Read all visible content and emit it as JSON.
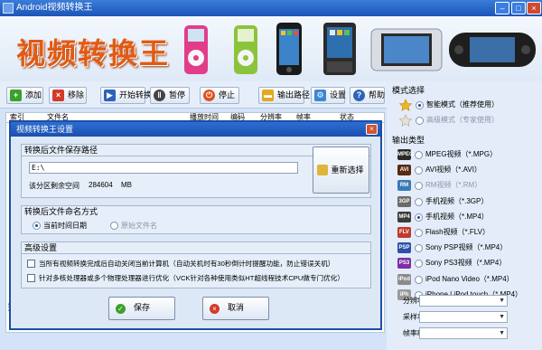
{
  "window": {
    "title": "Android视频转换王",
    "minimize": "–",
    "maximize": "□",
    "close": "×"
  },
  "banner": {
    "logo_text": "视频转换王",
    "device_names": [
      "ipod-nano",
      "ipod-shuffle",
      "iphone",
      "android-phone",
      "ipod-touch",
      "psp"
    ]
  },
  "toolbar": {
    "add": "添加",
    "remove": "移除",
    "start": "开始转换",
    "pause": "暂停",
    "stop": "停止",
    "output_path": "输出路径",
    "settings": "设置",
    "help": "帮助"
  },
  "file_list": {
    "columns": [
      "索引",
      "文件名",
      "播放时间",
      "编码",
      "分辨率",
      "帧率",
      "状态"
    ],
    "bottom_fragment": "当"
  },
  "right_panel": {
    "mode_title": "模式选择",
    "mode_smart": "智能模式（推荐使用）",
    "mode_advanced": "高级模式（专家使用）",
    "output_type_title": "输出类型",
    "formats": [
      {
        "icon": "MPEG",
        "label": "MPEG视频（*.MPG）",
        "color": "#2a2a2a",
        "selected": false,
        "disabled": false
      },
      {
        "icon": "AVI",
        "label": "AVI视频（*.AVI）",
        "color": "#5a2a10",
        "selected": false,
        "disabled": false
      },
      {
        "icon": "RM",
        "label": "RM视频（*.RM）",
        "color": "#3a7ab8",
        "selected": false,
        "disabled": true
      },
      {
        "icon": "3GP",
        "label": "手机视频（*.3GP）",
        "color": "#6b6b6b",
        "selected": false,
        "disabled": false
      },
      {
        "icon": "MP4",
        "label": "手机视频（*.MP4）",
        "color": "#3b3b3b",
        "selected": true,
        "disabled": false
      },
      {
        "icon": "FLV",
        "label": "Flash视频（*.FLV）",
        "color": "#c0392b",
        "selected": false,
        "disabled": false
      },
      {
        "icon": "PSP",
        "label": "Sony PSP视频（*.MP4）",
        "color": "#2f4fa8",
        "selected": false,
        "disabled": false
      },
      {
        "icon": "PS3",
        "label": "Sony PS3视频（*.MP4）",
        "color": "#7b2fa8",
        "selected": false,
        "disabled": false
      },
      {
        "icon": "iPod",
        "label": "iPod Nano Video（*.MP4）",
        "color": "#8a8a8a",
        "selected": false,
        "disabled": false
      },
      {
        "icon": "iPh",
        "label": "iPhone | iPod touch（*.MP4）",
        "color": "#9a9a9a",
        "selected": false,
        "disabled": false
      }
    ],
    "resolution_label": "分辨率",
    "sample_rate_label": "采样率",
    "fps_label": "帧率FPS"
  },
  "dialog": {
    "title": "视频转换王设置",
    "close": "×",
    "save_path": {
      "group_title": "转换后文件保存路径",
      "path_value": "E:\\",
      "free_space_label": "该分区剩余空间",
      "free_space_value": "284604",
      "free_space_unit": "MB",
      "reselect_button": "重新选择"
    },
    "naming": {
      "group_title": "转换后文件命名方式",
      "option_current_time": "当前时间日期",
      "option_original_name": "原始文件名"
    },
    "advanced": {
      "group_title": "高级设置",
      "option_shutdown": "当所有视频转换完成后自动关闭当前计算机（自动关机时有30秒倒计时提醒功能，防止错误关机）",
      "option_multicore": "针对多核处理器或多个物理处理器进行优化（VCK针对各种使用类似HT超线程技术CPU做专门优化）"
    },
    "save_button": "保存",
    "cancel_button": "取消"
  }
}
